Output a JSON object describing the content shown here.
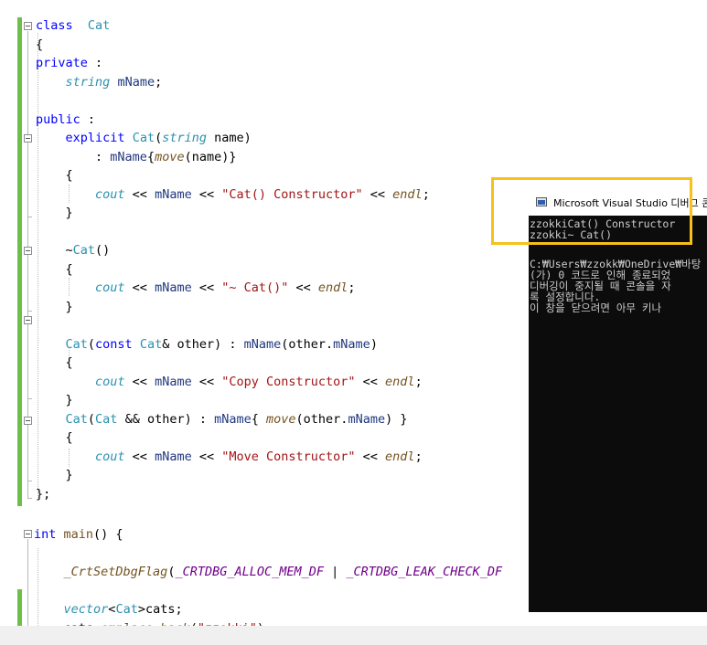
{
  "editor": {
    "lines": [
      [
        [
          "kw",
          "class"
        ],
        [
          "",
          "  "
        ],
        [
          "ty",
          "Cat"
        ]
      ],
      [
        [
          "",
          "{"
        ]
      ],
      [
        [
          "kw",
          "private"
        ],
        [
          "",
          " :"
        ]
      ],
      [
        [
          "",
          "    "
        ],
        [
          "typ",
          "string"
        ],
        [
          "",
          " "
        ],
        [
          "mem",
          "mName"
        ],
        [
          "",
          ";"
        ]
      ],
      [],
      [
        [
          "kw",
          "public"
        ],
        [
          "",
          " :"
        ]
      ],
      [
        [
          "",
          "    "
        ],
        [
          "kw",
          "explicit"
        ],
        [
          "",
          " "
        ],
        [
          "ty",
          "Cat"
        ],
        [
          "",
          "("
        ],
        [
          "typ",
          "string"
        ],
        [
          "",
          " name)"
        ]
      ],
      [
        [
          "",
          "        : "
        ],
        [
          "mem",
          "mName"
        ],
        [
          "",
          "{"
        ],
        [
          "fni",
          "move"
        ],
        [
          "",
          "(name)}"
        ]
      ],
      [
        [
          "",
          "    {"
        ]
      ],
      [
        [
          "",
          "        "
        ],
        [
          "typ",
          "cout"
        ],
        [
          "",
          " << "
        ],
        [
          "mem",
          "mName"
        ],
        [
          "",
          " << "
        ],
        [
          "str",
          "\"Cat() Constructor\""
        ],
        [
          "",
          " << "
        ],
        [
          "fni",
          "endl"
        ],
        [
          "",
          ";"
        ]
      ],
      [
        [
          "",
          "    }"
        ]
      ],
      [],
      [
        [
          "",
          "    ~"
        ],
        [
          "ty",
          "Cat"
        ],
        [
          "",
          "()"
        ]
      ],
      [
        [
          "",
          "    {"
        ]
      ],
      [
        [
          "",
          "        "
        ],
        [
          "typ",
          "cout"
        ],
        [
          "",
          " << "
        ],
        [
          "mem",
          "mName"
        ],
        [
          "",
          " << "
        ],
        [
          "str",
          "\"~ Cat()\""
        ],
        [
          "",
          " << "
        ],
        [
          "fni",
          "endl"
        ],
        [
          "",
          ";"
        ]
      ],
      [
        [
          "",
          "    }"
        ]
      ],
      [],
      [
        [
          "",
          "    "
        ],
        [
          "ty",
          "Cat"
        ],
        [
          "",
          "("
        ],
        [
          "kw",
          "const"
        ],
        [
          "",
          " "
        ],
        [
          "ty",
          "Cat"
        ],
        [
          "",
          "& other) : "
        ],
        [
          "mem",
          "mName"
        ],
        [
          "",
          "(other."
        ],
        [
          "mem",
          "mName"
        ],
        [
          "",
          ")"
        ]
      ],
      [
        [
          "",
          "    {"
        ]
      ],
      [
        [
          "",
          "        "
        ],
        [
          "typ",
          "cout"
        ],
        [
          "",
          " << "
        ],
        [
          "mem",
          "mName"
        ],
        [
          "",
          " << "
        ],
        [
          "str",
          "\"Copy Constructor\""
        ],
        [
          "",
          " << "
        ],
        [
          "fni",
          "endl"
        ],
        [
          "",
          ";"
        ]
      ],
      [
        [
          "",
          "    }"
        ]
      ],
      [
        [
          "",
          "    "
        ],
        [
          "ty",
          "Cat"
        ],
        [
          "",
          "("
        ],
        [
          "ty",
          "Cat"
        ],
        [
          "",
          " && other) : "
        ],
        [
          "mem",
          "mName"
        ],
        [
          "",
          "{ "
        ],
        [
          "fni",
          "move"
        ],
        [
          "",
          "(other."
        ],
        [
          "mem",
          "mName"
        ],
        [
          "",
          ") }"
        ]
      ],
      [
        [
          "",
          "    {"
        ]
      ],
      [
        [
          "",
          "        "
        ],
        [
          "typ",
          "cout"
        ],
        [
          "",
          " << "
        ],
        [
          "mem",
          "mName"
        ],
        [
          "",
          " << "
        ],
        [
          "str",
          "\"Move Constructor\""
        ],
        [
          "",
          " << "
        ],
        [
          "fni",
          "endl"
        ],
        [
          "",
          ";"
        ]
      ],
      [
        [
          "",
          "    }"
        ]
      ],
      [
        [
          "",
          "};"
        ]
      ]
    ],
    "main_lines": [
      [
        [
          "kw",
          "int"
        ],
        [
          "",
          " "
        ],
        [
          "fn",
          "main"
        ],
        [
          "",
          "() {"
        ]
      ],
      [],
      [
        [
          "",
          "    "
        ],
        [
          "fni",
          "_CrtSetDbgFlag"
        ],
        [
          "",
          "("
        ],
        [
          "mac",
          "_CRTDBG_ALLOC_MEM_DF"
        ],
        [
          "",
          " | "
        ],
        [
          "mac",
          "_CRTDBG_LEAK_CHECK_DF"
        ]
      ],
      [],
      [
        [
          "",
          "    "
        ],
        [
          "typ",
          "vector"
        ],
        [
          "",
          "<"
        ],
        [
          "ty",
          "Cat"
        ],
        [
          "",
          ">cats;"
        ]
      ],
      [
        [
          "",
          "    cats."
        ],
        [
          "fni",
          "emplace_back"
        ],
        [
          "",
          "("
        ],
        [
          "str",
          "\"zzokki\""
        ],
        [
          "",
          ");"
        ]
      ]
    ]
  },
  "console": {
    "title": "Microsoft Visual Studio 디버그 콘솔",
    "lines": [
      "zzokkiCat() Constructor",
      "zzokki~ Cat()",
      "",
      "C:₩Users₩zzokk₩OneDrive₩바탕",
      "(가) 0 코드로 인해 종료되었",
      "디버깅이 중지될 때 콘솔을 자",
      "록 설정합니다.",
      "이 창을 닫으려면 아무 키나"
    ]
  }
}
